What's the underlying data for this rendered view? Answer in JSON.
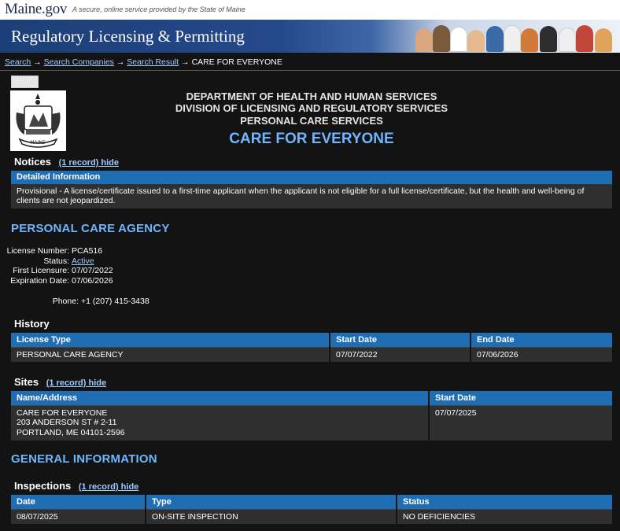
{
  "site": {
    "logo": "Maine.gov",
    "tagline": "A secure, online service provided by the State of Maine",
    "banner_title": "Regulatory Licensing & Permitting"
  },
  "breadcrumb": {
    "items": [
      "Search",
      "Search Companies",
      "Search Result"
    ],
    "current": "CARE FOR EVERYONE",
    "sep": "→"
  },
  "toolbar": {
    "print_label": "Print"
  },
  "header": {
    "dept": "DEPARTMENT OF HEALTH AND HUMAN SERVICES",
    "division": "DIVISION OF LICENSING AND REGULATORY SERVICES",
    "service": "PERSONAL CARE SERVICES",
    "facility": "CARE FOR EVERYONE"
  },
  "notices": {
    "title": "Notices",
    "toggle": "(1 record) hide",
    "head": "Detailed Information",
    "text": "Provisional - A license/certificate issued to a first-time applicant when the applicant is not eligible for a full license/certificate, but the health and well-being of clients are not jeopardized."
  },
  "license": {
    "heading": "PERSONAL CARE AGENCY",
    "number_label": "License Number:",
    "number": "PCA516",
    "status_label": "Status:",
    "status": "Active",
    "first_label": "First Licensure:",
    "first": "07/07/2022",
    "exp_label": "Expiration Date:",
    "exp": "07/06/2026",
    "phone_label": "Phone:",
    "phone": "+1 (207) 415-3438"
  },
  "history": {
    "title": "History",
    "columns": [
      "License Type",
      "Start Date",
      "End Date"
    ],
    "rows": [
      [
        "PERSONAL CARE AGENCY",
        "07/07/2022",
        "07/06/2026"
      ]
    ]
  },
  "sites": {
    "title": "Sites",
    "toggle": "(1 record) hide",
    "columns": [
      "Name/Address",
      "Start Date"
    ],
    "row": {
      "name": "CARE FOR EVERYONE",
      "addr1": "203 ANDERSON ST # 2-11",
      "addr2": "PORTLAND, ME 04101-2596",
      "start": "07/07/2025"
    }
  },
  "general": {
    "heading": "GENERAL INFORMATION"
  },
  "inspections": {
    "title": "Inspections",
    "toggle": "(1 record) hide",
    "columns": [
      "Date",
      "Type",
      "Status"
    ],
    "rows": [
      [
        "08/07/2025",
        "ON-SITE INSPECTION",
        "NO DEFICIENCIES"
      ]
    ]
  },
  "colors": {
    "accent": "#1f6db3",
    "link": "#9ecbff",
    "heading_blue": "#6fb6ff",
    "background": "#131313"
  }
}
